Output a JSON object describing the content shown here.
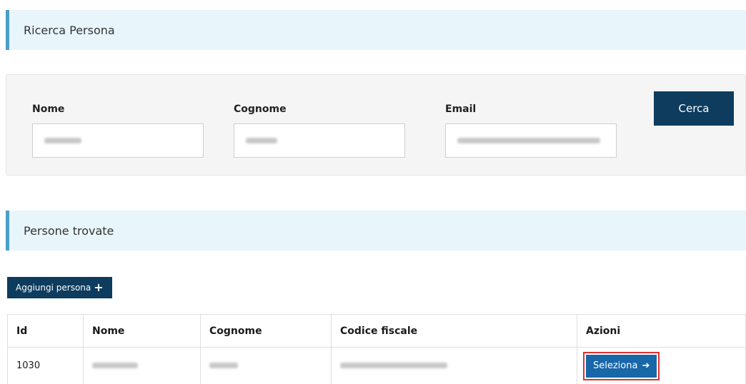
{
  "search_section": {
    "title": "Ricerca Persona"
  },
  "search_form": {
    "nome_label": "Nome",
    "cognome_label": "Cognome",
    "email_label": "Email",
    "cerca_label": "Cerca"
  },
  "results_section": {
    "title": "Persone trovate"
  },
  "add_button": {
    "label": "Aggiungi persona",
    "icon": "plus-icon"
  },
  "table": {
    "headers": [
      "Id",
      "Nome",
      "Cognome",
      "Codice fiscale",
      "Azioni"
    ],
    "rows": [
      {
        "id": "1030",
        "action_label": "Seleziona",
        "action_icon": "arrow-right-icon"
      }
    ]
  },
  "colors": {
    "primary_dark": "#0d3c5e",
    "primary_blue": "#1867a8",
    "header_bg": "#e8f5fb",
    "header_accent": "#4a9fc9",
    "highlight": "#e03030"
  }
}
